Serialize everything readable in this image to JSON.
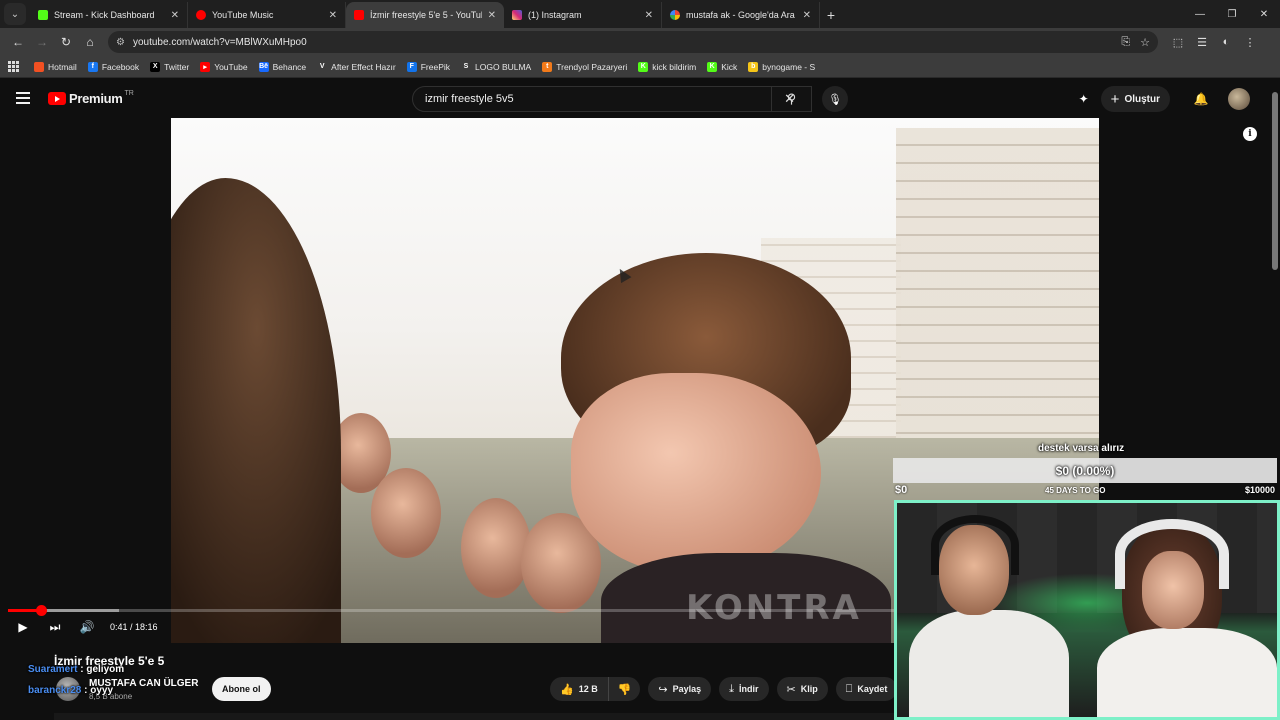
{
  "browser": {
    "tabs": [
      {
        "title": "Stream - Kick Dashboard",
        "icon": "kick-icon",
        "color": "#53fc18",
        "active": false
      },
      {
        "title": "YouTube Music",
        "icon": "youtube-music-icon",
        "color": "#ff0000",
        "active": false
      },
      {
        "title": "İzmir freestyle 5'e 5 - YouTube",
        "icon": "youtube-icon",
        "color": "#ff0000",
        "active": true
      },
      {
        "title": "(1) Instagram",
        "icon": "instagram-icon",
        "color": "#d62976",
        "active": false
      },
      {
        "title": "mustafa ak - Google'da Ara",
        "icon": "google-icon",
        "color": "#4285f4",
        "active": false
      }
    ],
    "url": "youtube.com/watch?v=MBlWXuMHpo0",
    "bookmarks": [
      {
        "label": "Hotmail",
        "icon": "microsoft-icon",
        "color": "#f25022",
        "glyph": ""
      },
      {
        "label": "Facebook",
        "icon": "facebook-icon",
        "color": "#1877f2",
        "glyph": "f"
      },
      {
        "label": "Twitter",
        "icon": "x-icon",
        "color": "#000000",
        "glyph": "X"
      },
      {
        "label": "YouTube",
        "icon": "youtube-icon",
        "color": "#ff0000",
        "glyph": "▸"
      },
      {
        "label": "Behance",
        "icon": "behance-icon",
        "color": "#1769ff",
        "glyph": "Bē"
      },
      {
        "label": "After Effect Hazır",
        "icon": "v-icon",
        "color": "#3c3c3c",
        "glyph": "V"
      },
      {
        "label": "FreePik",
        "icon": "freepik-icon",
        "color": "#1273eb",
        "glyph": "F"
      },
      {
        "label": "LOGO BULMA",
        "icon": "s-icon",
        "color": "#3c3c3c",
        "glyph": "S"
      },
      {
        "label": "Trendyol Pazaryeri",
        "icon": "trendyol-icon",
        "color": "#f27a1a",
        "glyph": "t"
      },
      {
        "label": "kick bildirim",
        "icon": "kick-icon",
        "color": "#53fc18",
        "glyph": "K"
      },
      {
        "label": "Kick",
        "icon": "kick-icon",
        "color": "#53fc18",
        "glyph": "K"
      },
      {
        "label": "bynogame - S",
        "icon": "bynogame-icon",
        "color": "#f5c518",
        "glyph": "b"
      }
    ]
  },
  "youtube": {
    "logo_text": "Premium",
    "logo_country": "TR",
    "search_value": "izmir freestyle 5v5",
    "create_label": "Oluştur",
    "video": {
      "title": "İzmir freestyle 5'e 5",
      "time_current": "0:41",
      "time_total": "18:16",
      "time_display": "0:41 / 18:16",
      "progress_fraction": 0.0374,
      "buffered_fraction": 0.125,
      "watermark": "KONTRA"
    },
    "channel": {
      "name": "MUSTAFA CAN ÜLGER",
      "subscribers": "8,5 B abone",
      "subscribe_label": "Abone ol"
    },
    "actions": {
      "likes": "12 B",
      "share": "Paylaş",
      "download": "İndir",
      "clip": "Klip",
      "save": "Kaydet"
    }
  },
  "chat": [
    {
      "user": "Suaramert",
      "sep": " : ",
      "message": "geliyom"
    },
    {
      "user": "baranckr28",
      "sep": " : ",
      "message": "oyyy"
    }
  ],
  "donation": {
    "title": "destek varsa alırız",
    "amount": "$0 (0.00%)",
    "min": "$0",
    "days_left": "45 DAYS TO GO",
    "max": "$10000",
    "progress_fraction": 0.0
  },
  "colors": {
    "accent_red": "#ff0000",
    "webcam_border": "#7ef0c8",
    "chat_user": "#4a8df0"
  }
}
